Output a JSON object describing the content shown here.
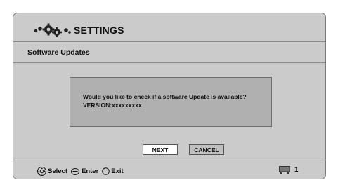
{
  "header": {
    "title": "SETTINGS",
    "icon": "settings-gears-icon"
  },
  "section": {
    "title": "Software Updates"
  },
  "dialog": {
    "line1": "Would you like to check if a software Update is available?",
    "line2": "VERSION:xxxxxxxxx"
  },
  "buttons": {
    "next": "NEXT",
    "cancel": "CANCEL"
  },
  "footer": {
    "select_label": "Select",
    "enter_label": "Enter",
    "exit_label": "Exit",
    "page_number": "1",
    "select_icon": "dpad-icon",
    "enter_icon": "enter-button-icon",
    "exit_icon": "exit-circle-icon",
    "page_icon": "screen-icon"
  }
}
